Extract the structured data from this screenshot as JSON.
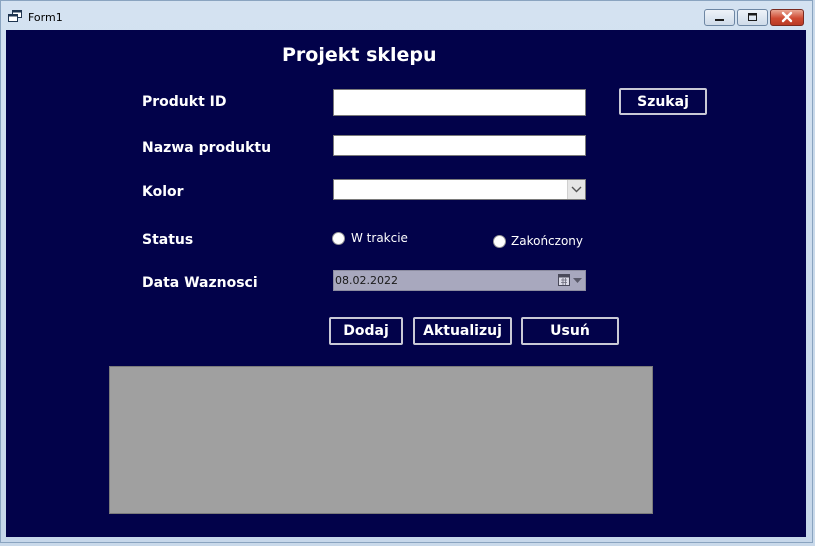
{
  "window": {
    "title": "Form1",
    "icon": "app-window-icon",
    "buttons": [
      "minimize-icon",
      "maximize-icon",
      "close-icon"
    ]
  },
  "form": {
    "heading": "Projekt sklepu",
    "labels": {
      "produkt_id": "Produkt ID",
      "nazwa": "Nazwa produktu",
      "kolor": "Kolor",
      "status": "Status",
      "data": "Data Waznosci"
    },
    "fields": {
      "produkt_id_value": "",
      "nazwa_value": "",
      "kolor_selected": ""
    },
    "status_options": [
      {
        "label": "W trakcie",
        "checked": false
      },
      {
        "label": "Zakończony",
        "checked": false
      }
    ],
    "date_value": "08.02.2022",
    "buttons": {
      "search": "Szukaj",
      "add": "Dodaj",
      "update": "Aktualizuj",
      "delete": "Usuń"
    },
    "colors": {
      "background": "#02024a",
      "grid": "#a0a0a0"
    }
  }
}
